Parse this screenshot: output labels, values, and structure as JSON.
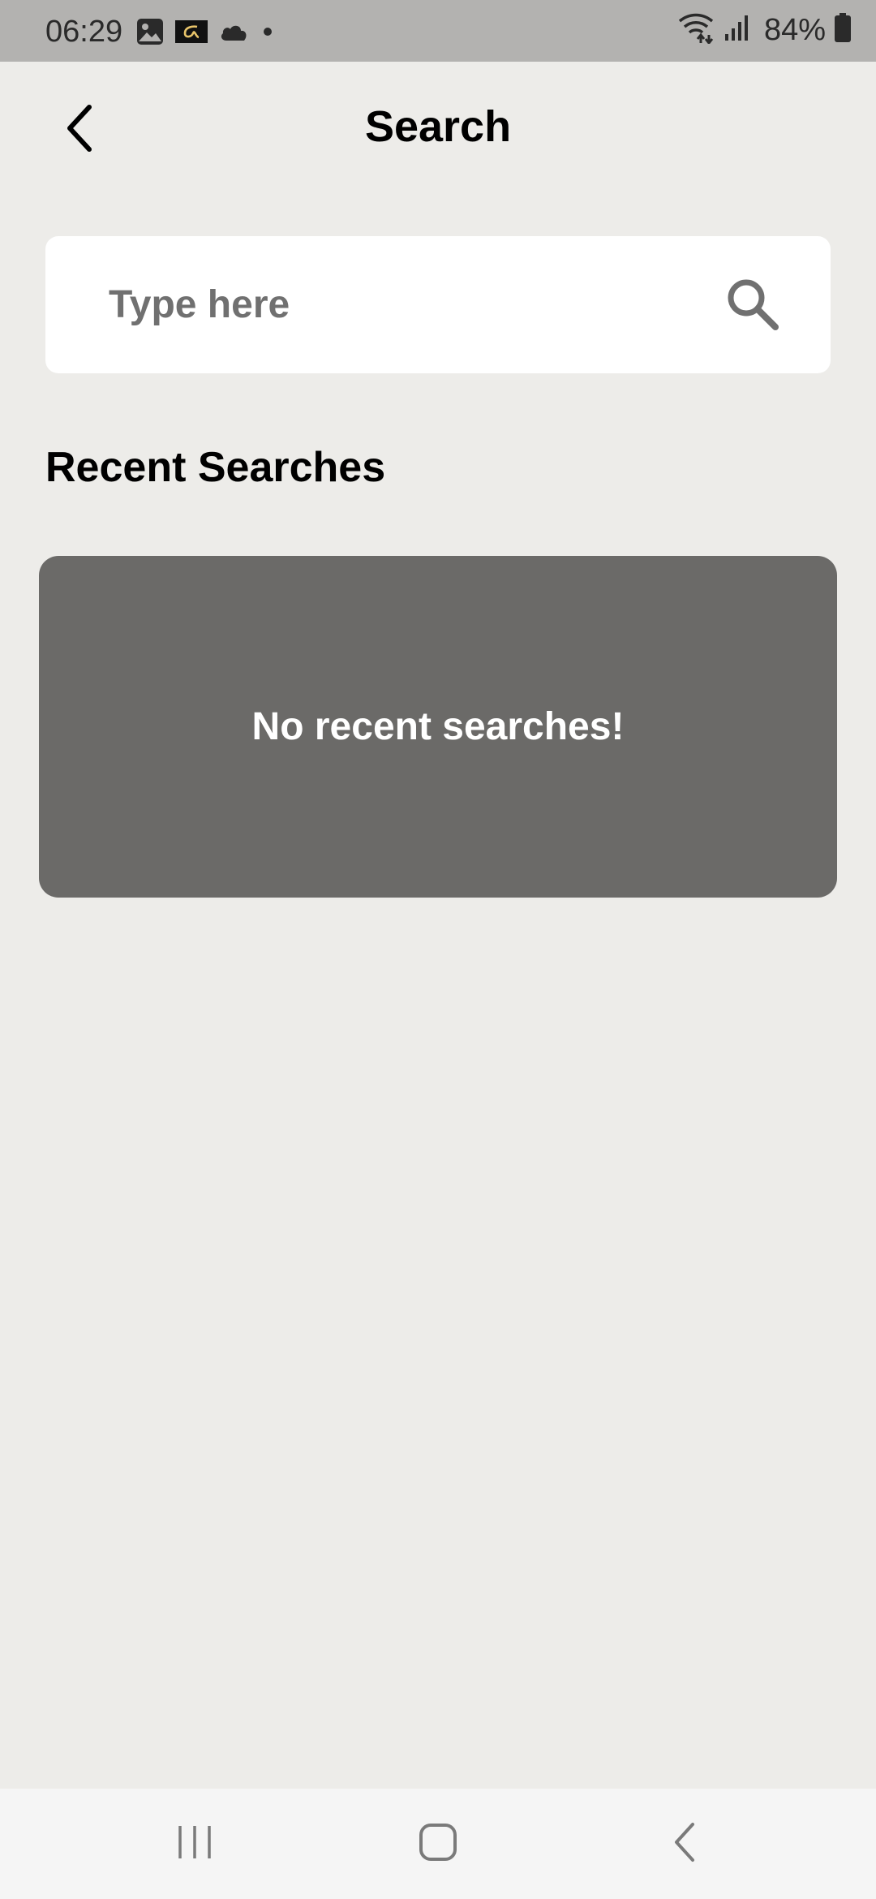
{
  "status_bar": {
    "time": "06:29",
    "battery": "84%",
    "left_icons": [
      "gallery-icon",
      "alpha-app-icon",
      "cloud-icon",
      "dot-icon"
    ],
    "right_icons": [
      "wifi-icon",
      "signal-icon",
      "battery-icon"
    ]
  },
  "header": {
    "title": "Search",
    "back_icon": "chevron-left-icon"
  },
  "search": {
    "placeholder": "Type here",
    "value": "",
    "icon": "search-icon"
  },
  "recent": {
    "title": "Recent Searches",
    "empty_message": "No recent searches!"
  },
  "nav_bar": {
    "buttons": [
      "recent-apps-icon",
      "home-icon",
      "back-icon"
    ]
  },
  "colors": {
    "background": "#EDECE9",
    "status_bar": "#B3B2B0",
    "card": "#6B6A68",
    "search_box": "#FFFFFF",
    "nav_bar": "#F5F5F5"
  }
}
